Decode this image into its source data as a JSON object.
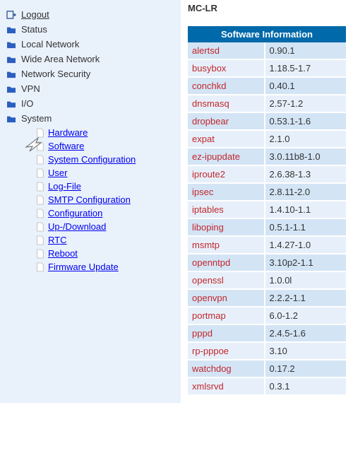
{
  "sidebar": {
    "items": [
      {
        "label": "Logout",
        "icon": "logout-icon",
        "link": true
      },
      {
        "label": "Status",
        "icon": "folder-icon",
        "link": false
      },
      {
        "label": "Local Network",
        "icon": "folder-icon",
        "link": false
      },
      {
        "label": "Wide Area Network",
        "icon": "folder-icon",
        "link": false
      },
      {
        "label": "Network Security",
        "icon": "folder-icon",
        "link": false
      },
      {
        "label": "VPN",
        "icon": "folder-icon",
        "link": false
      },
      {
        "label": "I/O",
        "icon": "folder-icon",
        "link": false
      },
      {
        "label": "System",
        "icon": "folder-open-icon",
        "link": false
      }
    ],
    "system_sub": [
      {
        "label": "Hardware"
      },
      {
        "label": "Software",
        "selected": true
      },
      {
        "label": "System Configuration"
      },
      {
        "label": "User"
      },
      {
        "label": "Log-File"
      },
      {
        "label": "SMTP Configuration"
      },
      {
        "label": "Configuration"
      },
      {
        "label": "Up-/Download"
      },
      {
        "label": "RTC"
      },
      {
        "label": "Reboot"
      },
      {
        "label": "Firmware Update"
      }
    ]
  },
  "main": {
    "title": "MC-LR",
    "table_header": "Software Information",
    "rows": [
      {
        "name": "alertsd",
        "ver": "0.90.1"
      },
      {
        "name": "busybox",
        "ver": "1.18.5-1.7"
      },
      {
        "name": "conchkd",
        "ver": "0.40.1"
      },
      {
        "name": "dnsmasq",
        "ver": "2.57-1.2"
      },
      {
        "name": "dropbear",
        "ver": "0.53.1-1.6"
      },
      {
        "name": "expat",
        "ver": "2.1.0"
      },
      {
        "name": "ez-ipupdate",
        "ver": "3.0.11b8-1.0"
      },
      {
        "name": "iproute2",
        "ver": "2.6.38-1.3"
      },
      {
        "name": "ipsec",
        "ver": "2.8.11-2.0"
      },
      {
        "name": "iptables",
        "ver": "1.4.10-1.1"
      },
      {
        "name": "liboping",
        "ver": "0.5.1-1.1"
      },
      {
        "name": "msmtp",
        "ver": "1.4.27-1.0"
      },
      {
        "name": "openntpd",
        "ver": "3.10p2-1.1"
      },
      {
        "name": "openssl",
        "ver": "1.0.0l"
      },
      {
        "name": "openvpn",
        "ver": "2.2.2-1.1"
      },
      {
        "name": "portmap",
        "ver": "6.0-1.2"
      },
      {
        "name": "pppd",
        "ver": "2.4.5-1.6"
      },
      {
        "name": "rp-pppoe",
        "ver": "3.10"
      },
      {
        "name": "watchdog",
        "ver": "0.17.2"
      },
      {
        "name": "xmlsrvd",
        "ver": "0.3.1"
      }
    ]
  }
}
